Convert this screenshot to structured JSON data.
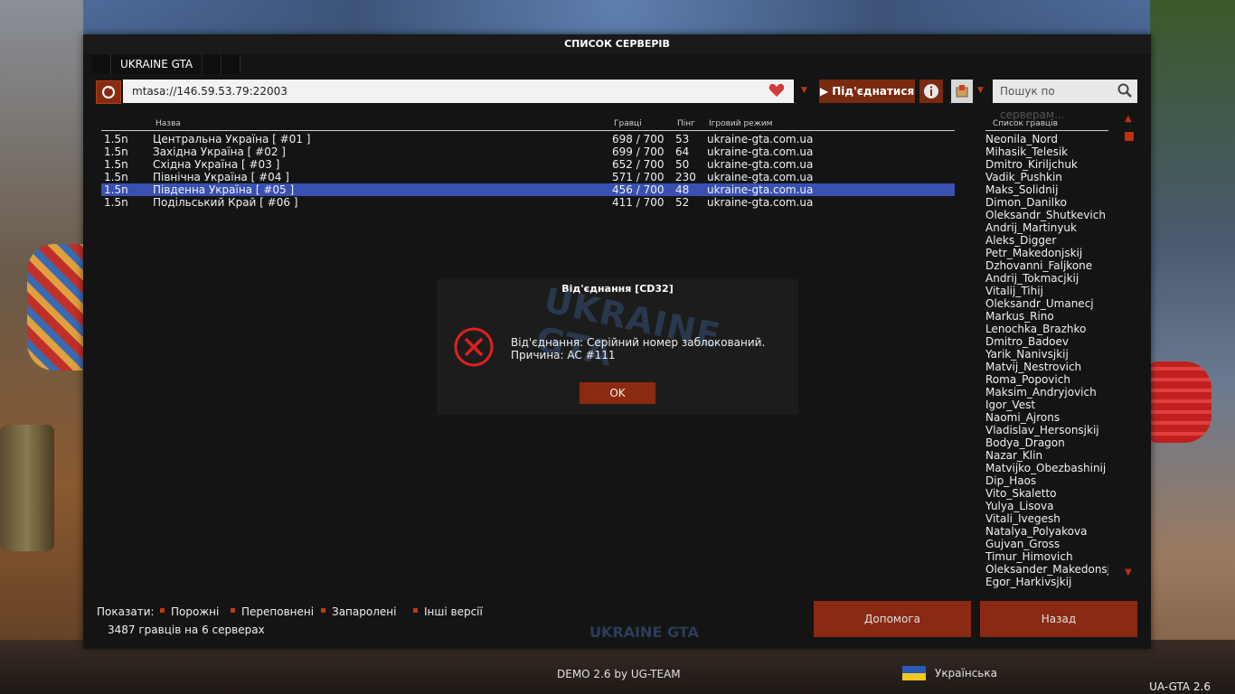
{
  "window": {
    "title": "СПИСОК СЕРВЕРІВ",
    "tab_label": "UKRAINE GTA"
  },
  "toolbar": {
    "address": "mtasa://146.59.53.79:22003",
    "connect_label": "Під'єднатися",
    "search_placeholder": "Пошук по серверам..."
  },
  "server_list": {
    "headers": {
      "name": "Назва",
      "players": "Гравці",
      "ping": "Пінг",
      "mode": "Ігровий режим"
    },
    "rows": [
      {
        "version": "1.5n",
        "name": "Центральна Україна [ #01 ]",
        "players": "698 / 700",
        "ping": "53",
        "mode": "ukraine-gta.com.ua",
        "selected": false
      },
      {
        "version": "1.5n",
        "name": "Західна Україна [ #02 ]",
        "players": "699 / 700",
        "ping": "64",
        "mode": "ukraine-gta.com.ua",
        "selected": false
      },
      {
        "version": "1.5n",
        "name": "Східна Україна [ #03 ]",
        "players": "652 / 700",
        "ping": "50",
        "mode": "ukraine-gta.com.ua",
        "selected": false
      },
      {
        "version": "1.5n",
        "name": "Північна Україна [ #04 ]",
        "players": "571 / 700",
        "ping": "230",
        "mode": "ukraine-gta.com.ua",
        "selected": false
      },
      {
        "version": "1.5n",
        "name": "Південна Україна [ #05 ]",
        "players": "456 / 700",
        "ping": "48",
        "mode": "ukraine-gta.com.ua",
        "selected": true
      },
      {
        "version": "1.5n",
        "name": "Подільський Край [ #06 ]",
        "players": "411 / 700",
        "ping": "52",
        "mode": "ukraine-gta.com.ua",
        "selected": false
      }
    ]
  },
  "players": {
    "header": "Список гравців",
    "items": [
      "Neonila_Nord",
      "Mihasik_Telesik",
      "Dmitro_Kiriljchuk",
      "Vadik_Pushkin",
      "Maks_Solidnij",
      "Dimon_Danilko",
      "Oleksandr_Shutkevich",
      "Andrij_Martinyuk",
      "Aleks_Digger",
      "Petr_Makedonjskij",
      "Dzhovanni_Faljkone",
      "Andrij_Tokmacjkij",
      "Vitalij_Tihij",
      "Oleksandr_Umanecj",
      "Markus_Rino",
      "Lenochka_Brazhko",
      "Dmitro_Badoev",
      "Yarik_Nanivsjkij",
      "Matvij_Nestrovich",
      "Roma_Popovich",
      "Maksim_Andryjovich",
      "Igor_Vest",
      "Naomi_Ajrons",
      "Vladislav_Hersonsjkij",
      "Bodya_Dragon",
      "Nazar_Klin",
      "Matvijko_Obezbashinij",
      "Dip_Haos",
      "Vito_Skaletto",
      "Yulya_Lisova",
      "Vitali_Ivegesh",
      "Natalya_Polyakova",
      "Gujvan_Gross",
      "Timur_Himovich",
      "Oleksander_Makedonsjk",
      "Egor_Harkivsjkij"
    ]
  },
  "filters": {
    "label": "Показати:",
    "empty": "Порожні",
    "full": "Переповнені",
    "locked": "Запаролені",
    "other": "Інші версії"
  },
  "status": {
    "count": "3487 гравців на 6 серверах"
  },
  "buttons": {
    "help": "Допомога",
    "back": "Назад"
  },
  "dialog": {
    "title": "Від'єднання [CD32]",
    "line1": "Від'єднання: Серійний номер заблокований.",
    "line2": "Причина: AC #111",
    "ok": "OK",
    "logo_text": "UKRAINE GTA"
  },
  "footer": {
    "credits": "DEMO 2.6 by UG-TEAM",
    "language": "Українська",
    "version": "UA-GTA 2.6",
    "logo_text": "UKRAINE GTA"
  },
  "colors": {
    "accent": "#8a2a10",
    "selection": "#3a50b0"
  }
}
